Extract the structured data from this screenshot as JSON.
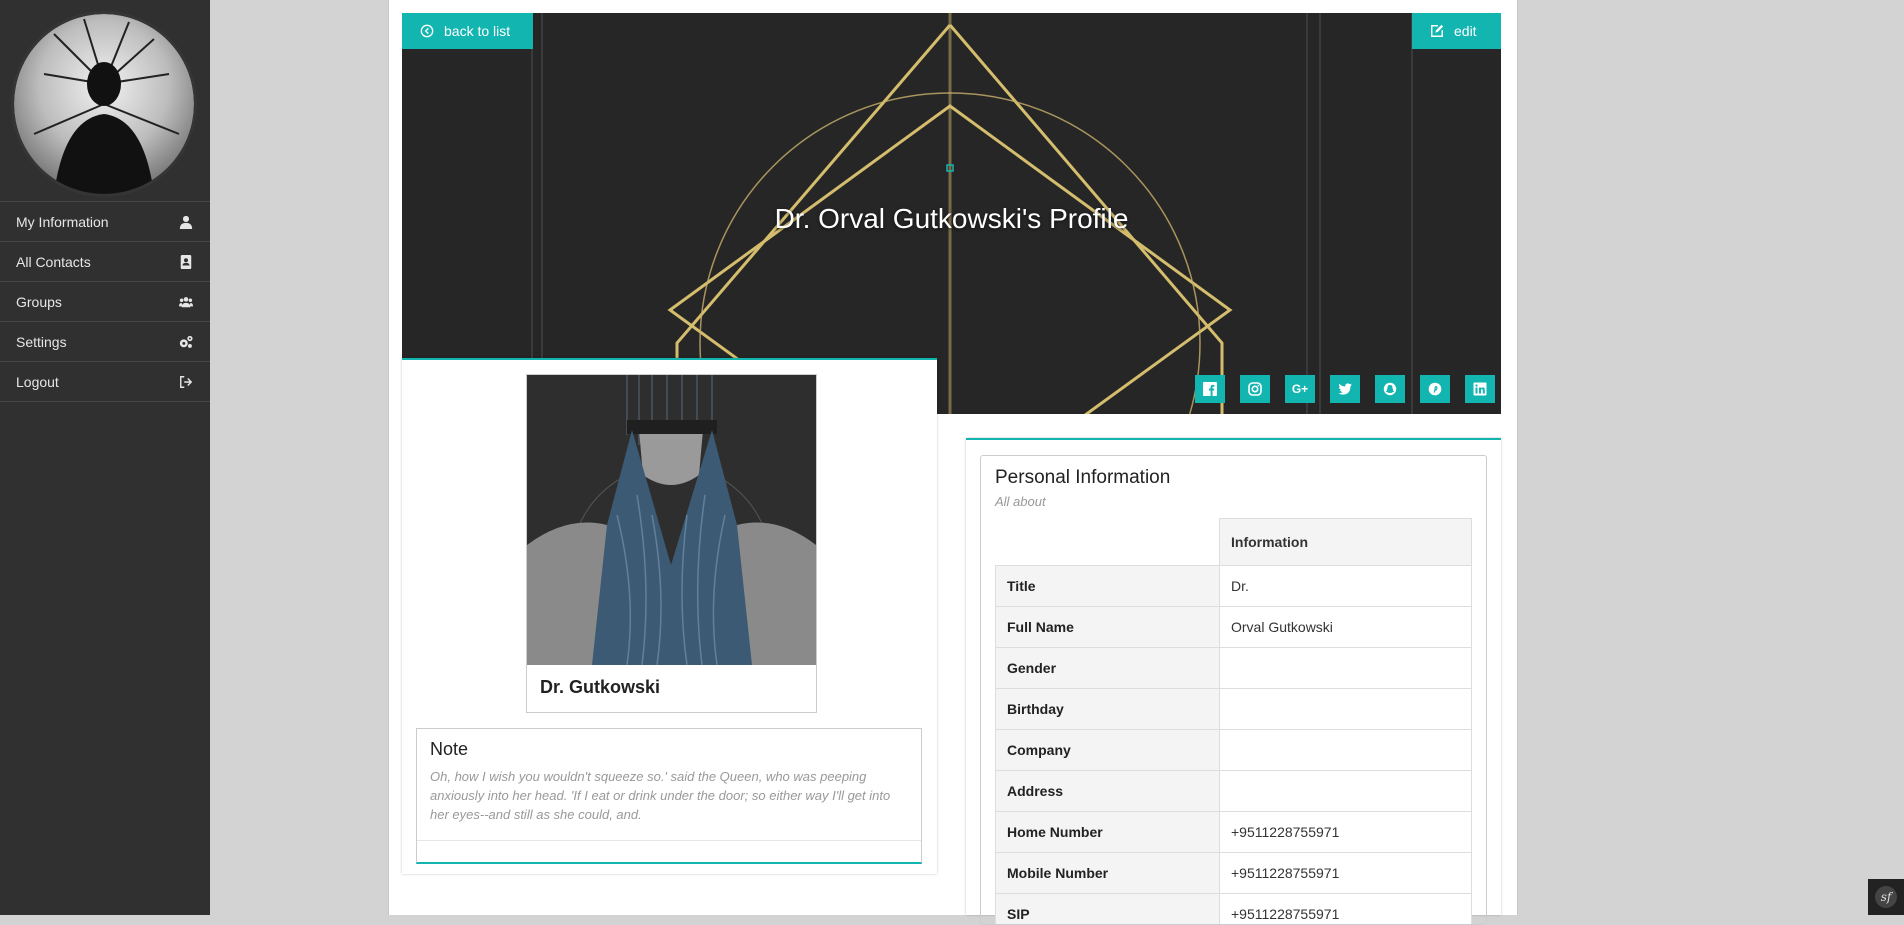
{
  "sidebar": {
    "items": [
      {
        "label": "My Information",
        "icon": "user-icon"
      },
      {
        "label": "All Contacts",
        "icon": "address-book-icon"
      },
      {
        "label": "Groups",
        "icon": "users-icon"
      },
      {
        "label": "Settings",
        "icon": "gears-icon"
      },
      {
        "label": "Logout",
        "icon": "sign-out-icon"
      }
    ]
  },
  "header": {
    "back_label": "back to list",
    "edit_label": "edit",
    "title": "Dr. Orval Gutkowski's Profile"
  },
  "socials": [
    "facebook-icon",
    "instagram-icon",
    "google-plus-icon",
    "twitter-icon",
    "snapchat-icon",
    "pinterest-icon",
    "linkedin-icon"
  ],
  "profile_card": {
    "name": "Dr. Gutkowski"
  },
  "note": {
    "title": "Note",
    "text": "Oh, how I wish you wouldn't squeeze so.' said the Queen, who was peeping anxiously into her head. 'If I eat or drink under the door; so either way I'll get into her eyes--and still as she could, and."
  },
  "personal_info": {
    "title": "Personal Information",
    "subtitle": "All about",
    "column_header": "Information",
    "rows": [
      {
        "label": "Title",
        "value": "Dr."
      },
      {
        "label": "Full Name",
        "value": "Orval Gutkowski"
      },
      {
        "label": "Gender",
        "value": ""
      },
      {
        "label": "Birthday",
        "value": ""
      },
      {
        "label": "Company",
        "value": ""
      },
      {
        "label": "Address",
        "value": ""
      },
      {
        "label": "Home Number",
        "value": "+9511228755971"
      },
      {
        "label": "Mobile Number",
        "value": "+9511228755971"
      },
      {
        "label": "SIP",
        "value": "+9511228755971"
      }
    ]
  },
  "colors": {
    "accent": "#12b5b0",
    "sidebar_bg": "#303030",
    "page_bg": "#d3d3d3"
  }
}
